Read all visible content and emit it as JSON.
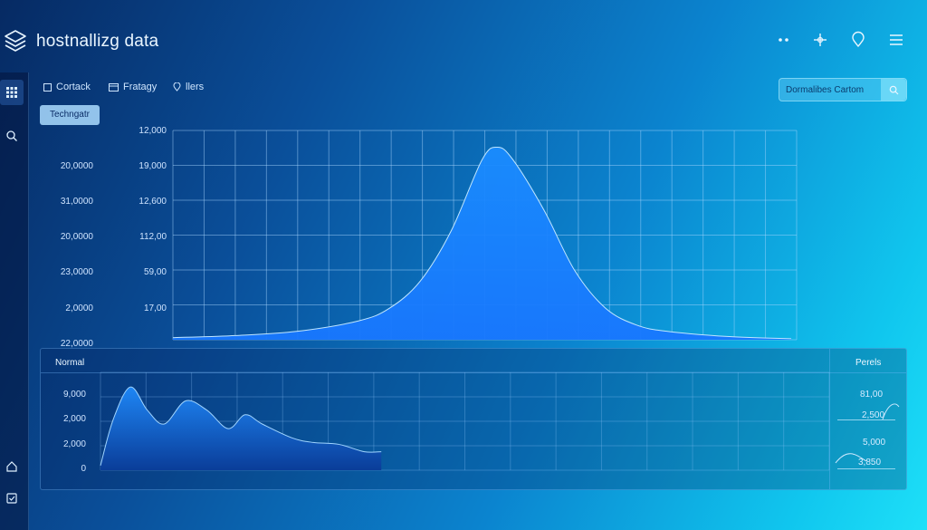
{
  "app": {
    "title": "hostnallizg data"
  },
  "header": {
    "icons": [
      "more-dots-icon",
      "crosshair-icon",
      "location-pin-icon",
      "hamburger-menu-icon"
    ]
  },
  "sidebar": {
    "icons": [
      "grid-icon",
      "search-icon",
      "home-icon",
      "checklist-icon"
    ]
  },
  "tabs": [
    {
      "label": "Cortack",
      "icon": "square-icon"
    },
    {
      "label": "Fratagy",
      "icon": "card-icon"
    },
    {
      "label": "llers",
      "icon": "pin-icon"
    }
  ],
  "chip": {
    "label": "Techngatr"
  },
  "search": {
    "placeholder": "Dormalibes Cartom"
  },
  "main_chart": {
    "left_axis_labels": [
      "20,0000",
      "31,0000",
      "20,0000",
      "23,0000",
      "2,0000",
      "22,0000"
    ],
    "right_axis_labels": [
      "12,000",
      "19,000",
      "12,600",
      "112,00",
      "59,00",
      "17,00"
    ]
  },
  "bottom_panel": {
    "title": "Normal",
    "right_title": "Perels",
    "y_labels": [
      "9,000",
      "2,000",
      "2,000",
      "0"
    ],
    "right_values": [
      "81,00",
      "2,500",
      "5,000",
      "3,850"
    ]
  },
  "chart_data": [
    {
      "type": "area",
      "title": "",
      "xlabel": "",
      "ylabel": "",
      "yticks_left": [
        "20,0000",
        "31,0000",
        "20,0000",
        "23,0000",
        "2,0000",
        "22,0000"
      ],
      "yticks_right": [
        "12,000",
        "19,000",
        "12,600",
        "112,00",
        "59,00",
        "17,00"
      ],
      "x": [
        0,
        0.1,
        0.2,
        0.3,
        0.35,
        0.4,
        0.45,
        0.5,
        0.525,
        0.55,
        0.6,
        0.65,
        0.7,
        0.75,
        0.8,
        0.9,
        1.0
      ],
      "y": [
        0.01,
        0.02,
        0.04,
        0.09,
        0.15,
        0.28,
        0.52,
        0.86,
        0.92,
        0.86,
        0.62,
        0.33,
        0.15,
        0.07,
        0.04,
        0.015,
        0.005
      ],
      "grid": true,
      "color": "#1590ff"
    },
    {
      "type": "area",
      "title": "Normal",
      "yticks": [
        "9,000",
        "2,000",
        "2,000",
        "0"
      ],
      "x": [
        0,
        0.03,
        0.07,
        0.11,
        0.15,
        0.2,
        0.25,
        0.3,
        0.34,
        0.38,
        0.45,
        0.5,
        0.56,
        0.62,
        0.66
      ],
      "y": [
        0.05,
        0.55,
        0.9,
        0.65,
        0.5,
        0.75,
        0.65,
        0.45,
        0.6,
        0.5,
        0.35,
        0.3,
        0.28,
        0.2,
        0.2
      ],
      "grid": true,
      "color": "#1a78f0"
    }
  ],
  "colors": {
    "accent": "#1590ff",
    "chip_bg": "#aadcff",
    "sidebar_bg": "#03143c"
  }
}
